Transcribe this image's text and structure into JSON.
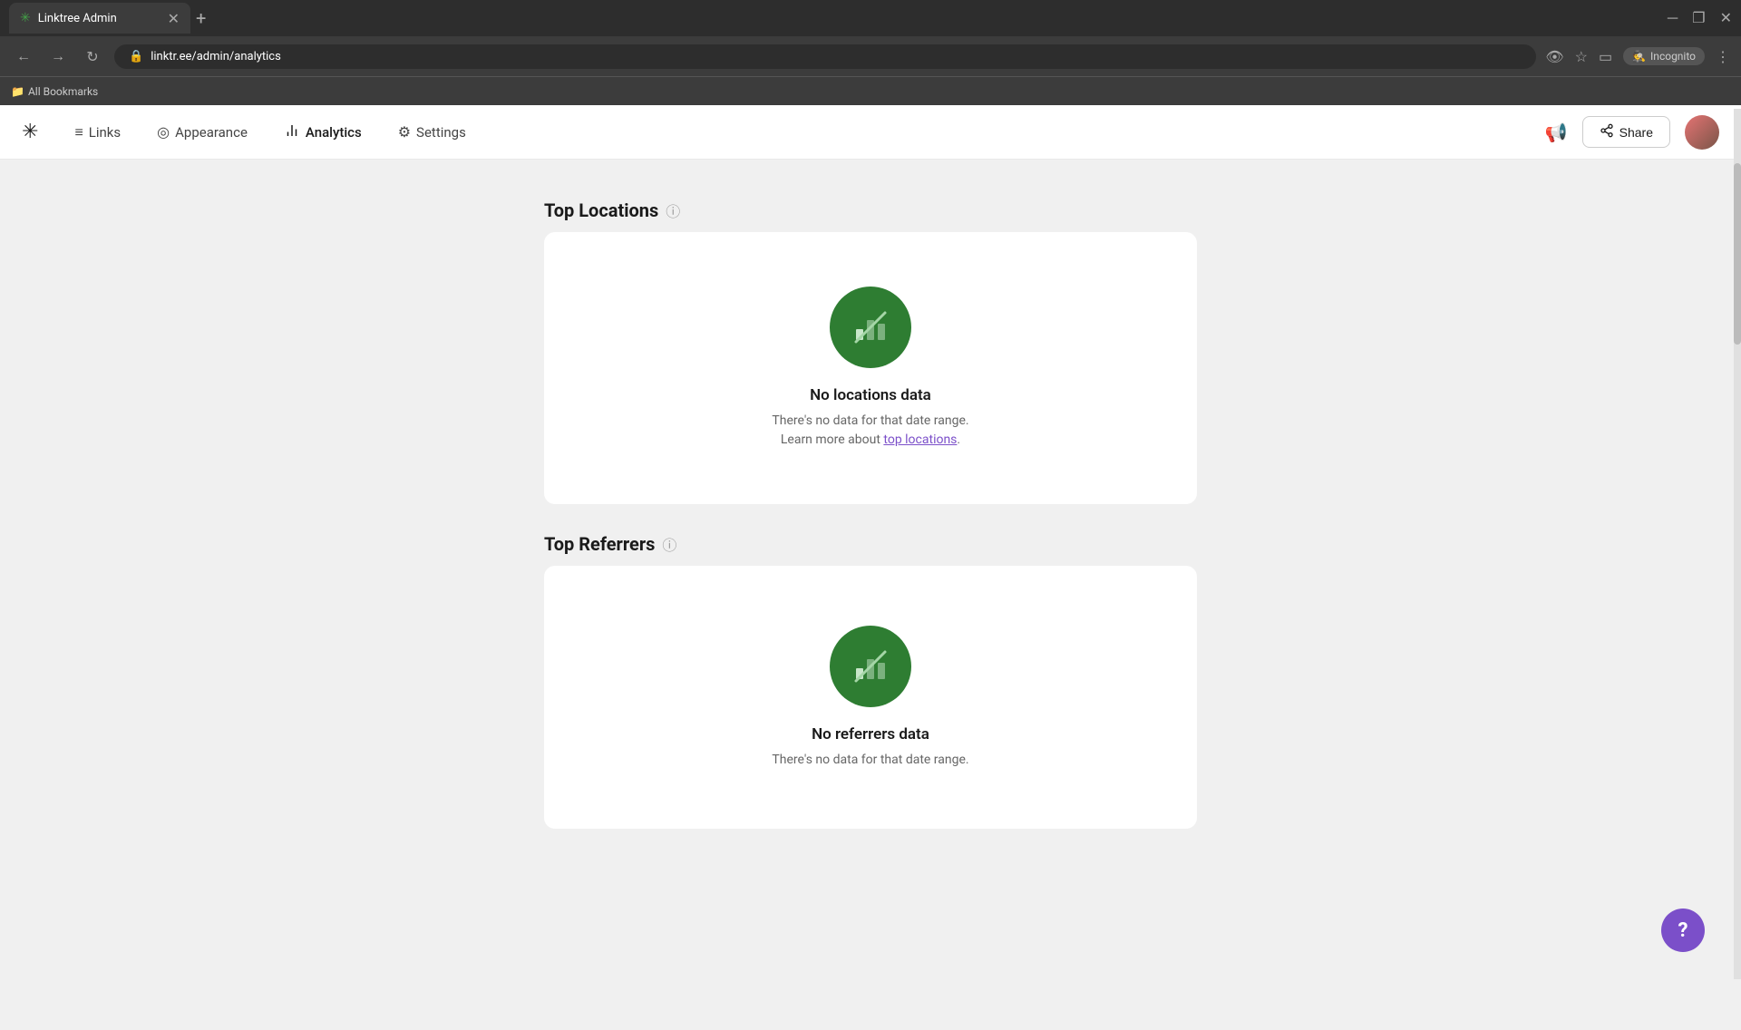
{
  "browser": {
    "tab_title": "Linktree Admin",
    "tab_favicon": "✳",
    "url": "linktr.ee/admin/analytics",
    "incognito_label": "Incognito",
    "bookmarks_label": "All Bookmarks"
  },
  "nav": {
    "logo": "✳",
    "links_label": "Links",
    "appearance_label": "Appearance",
    "analytics_label": "Analytics",
    "settings_label": "Settings",
    "share_label": "Share"
  },
  "top_locations": {
    "title": "Top Locations",
    "no_data_title": "No locations data",
    "no_data_desc_prefix": "There's no data for that date range.",
    "no_data_desc_link_prefix": "Learn more about ",
    "no_data_link_text": "top locations",
    "no_data_desc_suffix": "."
  },
  "top_referrers": {
    "title": "Top Referrers",
    "no_data_title": "No referrers data",
    "no_data_desc_prefix": "There's no data for that date range."
  },
  "help": {
    "label": "?"
  }
}
